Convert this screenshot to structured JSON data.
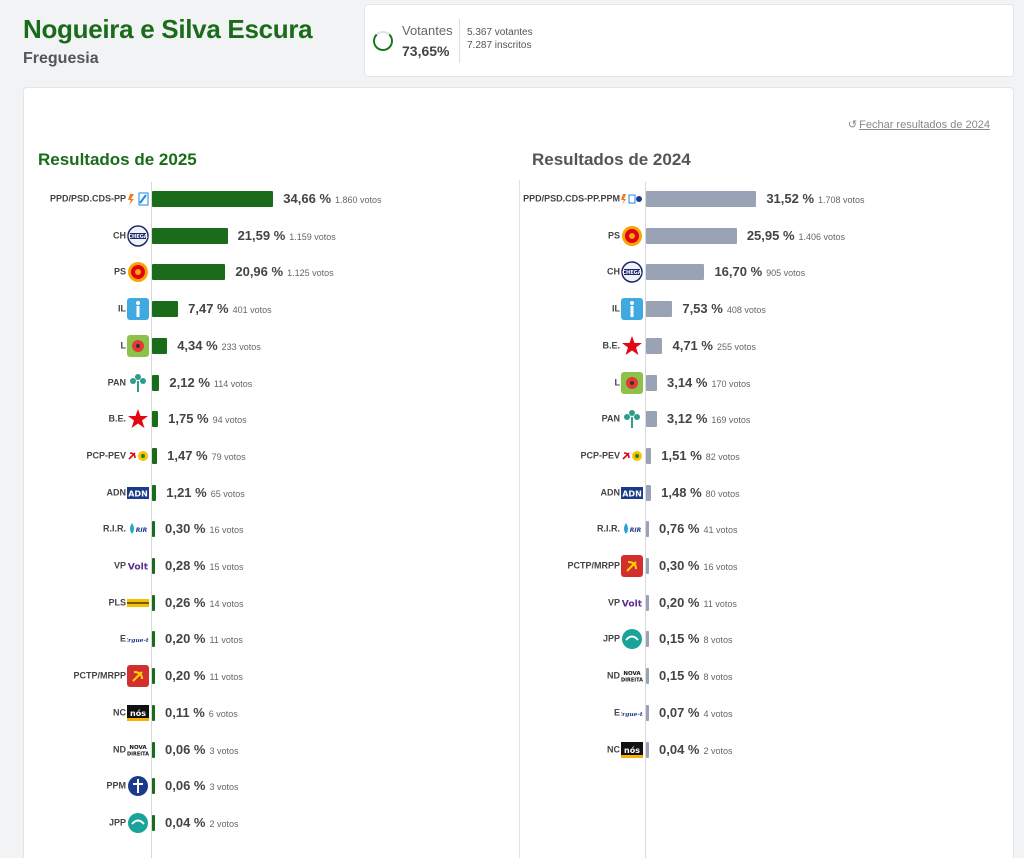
{
  "header": {
    "title": "Nogueira e Silva Escura",
    "subtitle": "Freguesia"
  },
  "turnout": {
    "label": "Votantes",
    "percent": "73,65%",
    "voters": "5.367 votantes",
    "registered": "7.287 inscritos",
    "fraction": 0.7365
  },
  "close_label": "Fechar resultados de 2024",
  "results_2025": {
    "title": "Resultados de 2025",
    "parties": [
      {
        "name": "PPD/PSD.CDS-PP",
        "logo": "psd-cds-logo",
        "pct": 34.66,
        "pct_label": "34,66 %",
        "votes": "1.860 votos"
      },
      {
        "name": "CH",
        "logo": "chega-logo",
        "pct": 21.59,
        "pct_label": "21,59 %",
        "votes": "1.159 votos"
      },
      {
        "name": "PS",
        "logo": "ps-logo",
        "pct": 20.96,
        "pct_label": "20,96 %",
        "votes": "1.125 votos"
      },
      {
        "name": "IL",
        "logo": "il-logo",
        "pct": 7.47,
        "pct_label": "7,47 %",
        "votes": "401 votos"
      },
      {
        "name": "L",
        "logo": "livre-logo",
        "pct": 4.34,
        "pct_label": "4,34 %",
        "votes": "233 votos"
      },
      {
        "name": "PAN",
        "logo": "pan-logo",
        "pct": 2.12,
        "pct_label": "2,12 %",
        "votes": "114 votos"
      },
      {
        "name": "B.E.",
        "logo": "be-logo",
        "pct": 1.75,
        "pct_label": "1,75 %",
        "votes": "94 votos"
      },
      {
        "name": "PCP-PEV",
        "logo": "pcp-pev-logo",
        "pct": 1.47,
        "pct_label": "1,47 %",
        "votes": "79 votos"
      },
      {
        "name": "ADN",
        "logo": "adn-logo",
        "pct": 1.21,
        "pct_label": "1,21 %",
        "votes": "65 votos"
      },
      {
        "name": "R.I.R.",
        "logo": "rir-logo",
        "pct": 0.3,
        "pct_label": "0,30 %",
        "votes": "16 votos"
      },
      {
        "name": "VP",
        "logo": "volt-logo",
        "pct": 0.28,
        "pct_label": "0,28 %",
        "votes": "15 votos"
      },
      {
        "name": "PLS",
        "logo": "pls-logo",
        "pct": 0.26,
        "pct_label": "0,26 %",
        "votes": "14 votos"
      },
      {
        "name": "E",
        "logo": "ergue-te-logo",
        "pct": 0.2,
        "pct_label": "0,20 %",
        "votes": "11 votos"
      },
      {
        "name": "PCTP/MRPP",
        "logo": "pctp-logo",
        "pct": 0.2,
        "pct_label": "0,20 %",
        "votes": "11 votos"
      },
      {
        "name": "NC",
        "logo": "nc-logo",
        "pct": 0.11,
        "pct_label": "0,11 %",
        "votes": "6 votos"
      },
      {
        "name": "ND",
        "logo": "nd-logo",
        "pct": 0.06,
        "pct_label": "0,06 %",
        "votes": "3 votos"
      },
      {
        "name": "PPM",
        "logo": "ppm-logo",
        "pct": 0.06,
        "pct_label": "0,06 %",
        "votes": "3 votos"
      },
      {
        "name": "JPP",
        "logo": "jpp-logo",
        "pct": 0.04,
        "pct_label": "0,04 %",
        "votes": "2 votos"
      }
    ]
  },
  "results_2024": {
    "title": "Resultados de 2024",
    "parties": [
      {
        "name": "PPD/PSD.CDS-PP.PPM",
        "logo": "psd-cds-ppm-logo",
        "pct": 31.52,
        "pct_label": "31,52 %",
        "votes": "1.708 votos"
      },
      {
        "name": "PS",
        "logo": "ps-logo",
        "pct": 25.95,
        "pct_label": "25,95 %",
        "votes": "1.406 votos"
      },
      {
        "name": "CH",
        "logo": "chega-logo",
        "pct": 16.7,
        "pct_label": "16,70 %",
        "votes": "905 votos"
      },
      {
        "name": "IL",
        "logo": "il-logo",
        "pct": 7.53,
        "pct_label": "7,53 %",
        "votes": "408 votos"
      },
      {
        "name": "B.E.",
        "logo": "be-logo",
        "pct": 4.71,
        "pct_label": "4,71 %",
        "votes": "255 votos"
      },
      {
        "name": "L",
        "logo": "livre-logo",
        "pct": 3.14,
        "pct_label": "3,14 %",
        "votes": "170 votos"
      },
      {
        "name": "PAN",
        "logo": "pan-logo",
        "pct": 3.12,
        "pct_label": "3,12 %",
        "votes": "169 votos"
      },
      {
        "name": "PCP-PEV",
        "logo": "pcp-pev-logo",
        "pct": 1.51,
        "pct_label": "1,51 %",
        "votes": "82 votos"
      },
      {
        "name": "ADN",
        "logo": "adn-logo",
        "pct": 1.48,
        "pct_label": "1,48 %",
        "votes": "80 votos"
      },
      {
        "name": "R.I.R.",
        "logo": "rir-logo",
        "pct": 0.76,
        "pct_label": "0,76 %",
        "votes": "41 votos"
      },
      {
        "name": "PCTP/MRPP",
        "logo": "pctp-logo",
        "pct": 0.3,
        "pct_label": "0,30 %",
        "votes": "16 votos"
      },
      {
        "name": "VP",
        "logo": "volt-logo",
        "pct": 0.2,
        "pct_label": "0,20 %",
        "votes": "11 votos"
      },
      {
        "name": "JPP",
        "logo": "jpp-logo",
        "pct": 0.15,
        "pct_label": "0,15 %",
        "votes": "8 votos"
      },
      {
        "name": "ND",
        "logo": "nd-logo",
        "pct": 0.15,
        "pct_label": "0,15 %",
        "votes": "8 votos"
      },
      {
        "name": "E",
        "logo": "ergue-te-logo",
        "pct": 0.07,
        "pct_label": "0,07 %",
        "votes": "4 votos"
      },
      {
        "name": "NC",
        "logo": "nc-logo",
        "pct": 0.04,
        "pct_label": "0,04 %",
        "votes": "2 votos"
      }
    ]
  },
  "colors": {
    "brand_green": "#1a6b1a",
    "bar_2025": "#1a6b1a",
    "bar_2024": "#9aa3b5"
  },
  "chart_data": [
    {
      "type": "bar",
      "title": "Resultados de 2025",
      "categories": [
        "PPD/PSD.CDS-PP",
        "CH",
        "PS",
        "IL",
        "L",
        "PAN",
        "B.E.",
        "PCP-PEV",
        "ADN",
        "R.I.R.",
        "VP",
        "PLS",
        "E",
        "PCTP/MRPP",
        "NC",
        "ND",
        "PPM",
        "JPP"
      ],
      "values": [
        34.66,
        21.59,
        20.96,
        7.47,
        4.34,
        2.12,
        1.75,
        1.47,
        1.21,
        0.3,
        0.28,
        0.26,
        0.2,
        0.2,
        0.11,
        0.06,
        0.06,
        0.04
      ],
      "votes": [
        1860,
        1159,
        1125,
        401,
        233,
        114,
        94,
        79,
        65,
        16,
        15,
        14,
        11,
        11,
        6,
        3,
        3,
        2
      ]
    },
    {
      "type": "bar",
      "title": "Resultados de 2024",
      "categories": [
        "PPD/PSD.CDS-PP.PPM",
        "PS",
        "CH",
        "IL",
        "B.E.",
        "L",
        "PAN",
        "PCP-PEV",
        "ADN",
        "R.I.R.",
        "PCTP/MRPP",
        "VP",
        "JPP",
        "ND",
        "E",
        "NC"
      ],
      "values": [
        31.52,
        25.95,
        16.7,
        7.53,
        4.71,
        3.14,
        3.12,
        1.51,
        1.48,
        0.76,
        0.3,
        0.2,
        0.15,
        0.15,
        0.07,
        0.04
      ],
      "votes": [
        1708,
        1406,
        905,
        408,
        255,
        170,
        169,
        82,
        80,
        41,
        16,
        11,
        8,
        8,
        4,
        2
      ]
    }
  ]
}
